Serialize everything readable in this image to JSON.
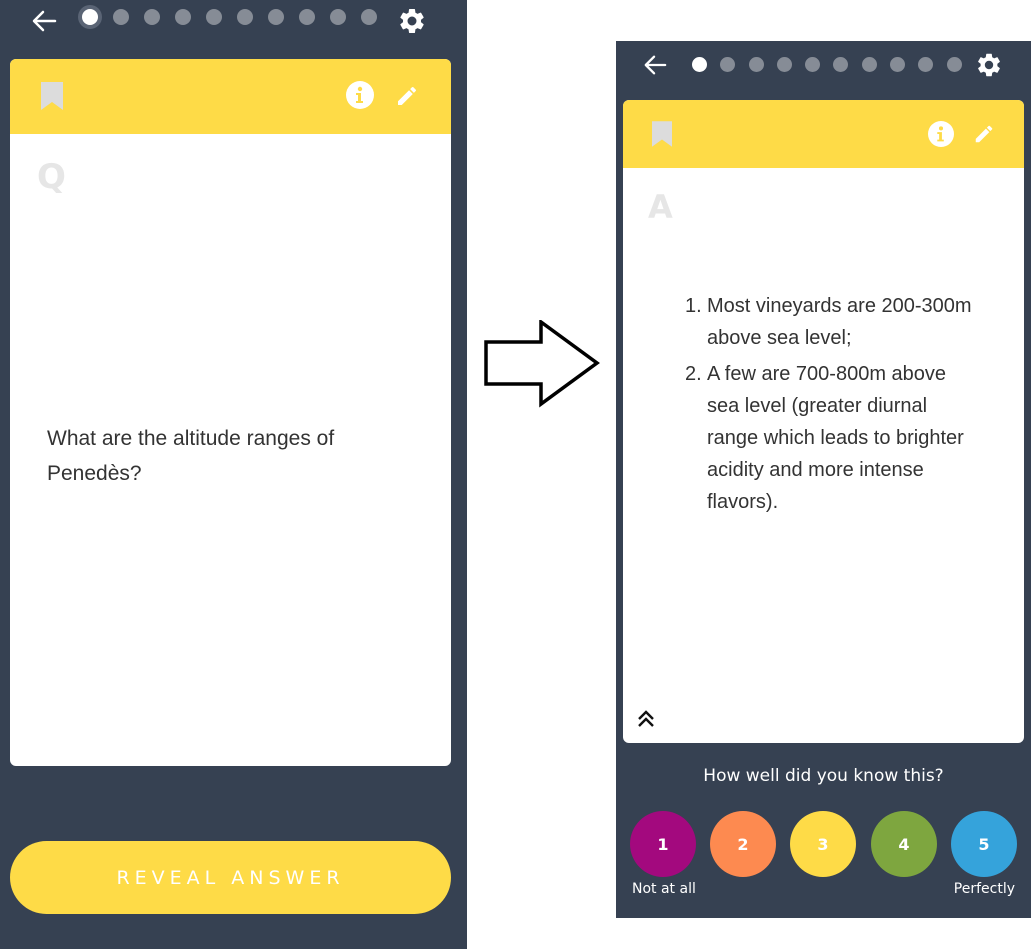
{
  "question_screen": {
    "progress": {
      "total": 10,
      "current": 1
    },
    "card_letter": "Q",
    "question": "What are the altitude ranges of Penedès?",
    "reveal_button": "REVEAL ANSWER"
  },
  "answer_screen": {
    "progress": {
      "total": 10,
      "current": 1
    },
    "card_letter": "A",
    "answer_items": [
      {
        "num": "1.",
        "text": "Most vineyards are 200-300m above sea level;"
      },
      {
        "num": "2.",
        "text": "A few are 700-800m above sea level (greater diurnal range which leads to brighter acidity and more intense flavors)."
      }
    ],
    "rating_prompt": "How well did you know this?",
    "ratings": [
      {
        "label": "1",
        "color": "#a3097e"
      },
      {
        "label": "2",
        "color": "#fd8a50"
      },
      {
        "label": "3",
        "color": "#fedb47"
      },
      {
        "label": "4",
        "color": "#7ea63f"
      },
      {
        "label": "5",
        "color": "#35a3db"
      }
    ],
    "rating_low_label": "Not at all",
    "rating_high_label": "Perfectly"
  },
  "colors": {
    "background": "#364152",
    "accent": "#fedb47",
    "dot_inactive": "#868c96"
  }
}
